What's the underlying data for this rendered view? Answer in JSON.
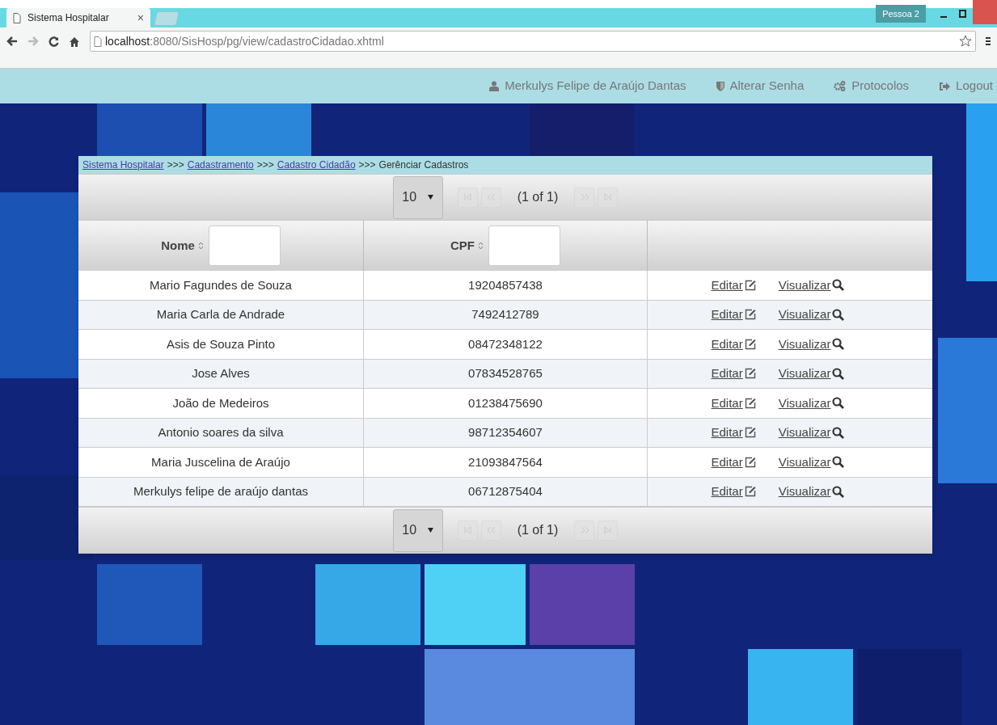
{
  "browser": {
    "tab_title": "Sistema Hospitalar",
    "tab_close": "×",
    "profile": "Pessoa 2",
    "url_host": "localhost",
    "url_path": ":8080/SisHosp/pg/view/cadastroCidadao.xhtml"
  },
  "navbar": {
    "items": [
      {
        "kind": "user",
        "label": "Merkulys Felipe de Araújo Dantas"
      },
      {
        "kind": "shield",
        "label": "Alterar Senha"
      },
      {
        "kind": "gears",
        "label": "Protocolos"
      },
      {
        "kind": "logout",
        "label": "Logout"
      }
    ]
  },
  "breadcrumb": {
    "links": [
      "Sistema Hospitalar",
      "Cadastramento",
      "Cadastro Cidadão"
    ],
    "separator": ">>>",
    "current": "Gerênciar Cadastros"
  },
  "paginator_top": {
    "page_size": "10",
    "report": "(1 of 1)",
    "buttons": [
      {
        "kind": "first",
        "disabled": true
      },
      {
        "kind": "prev",
        "disabled": true
      },
      {
        "kind": "next",
        "disabled": true
      },
      {
        "kind": "last",
        "disabled": true
      }
    ]
  },
  "table": {
    "columns": [
      {
        "label": "Nome",
        "sortable": true,
        "filter": true
      },
      {
        "label": "CPF",
        "sortable": true,
        "filter": true
      },
      {
        "sortable": false,
        "filter": false
      }
    ],
    "rows": [
      {
        "nome": "Mario Fagundes de Souza",
        "cpf": "19204857438",
        "actions": [
          "Editar",
          "Visualizar"
        ]
      },
      {
        "nome": "Maria Carla de Andrade",
        "cpf": "7492412789",
        "actions": [
          "Editar",
          "Visualizar"
        ]
      },
      {
        "nome": "Asis de Souza Pinto",
        "cpf": "08472348122",
        "actions": [
          "Editar",
          "Visualizar"
        ]
      },
      {
        "nome": "Jose Alves",
        "cpf": "07834528765",
        "actions": [
          "Editar",
          "Visualizar"
        ]
      },
      {
        "nome": "João de Medeiros",
        "cpf": "01238475690",
        "actions": [
          "Editar",
          "Visualizar"
        ]
      },
      {
        "nome": "Antonio soares da silva",
        "cpf": "98712354607",
        "actions": [
          "Editar",
          "Visualizar"
        ]
      },
      {
        "nome": "Maria Juscelina de Araújo",
        "cpf": "21093847564",
        "actions": [
          "Editar",
          "Visualizar"
        ]
      },
      {
        "nome": "Merkulys felipe de araújo dantas",
        "cpf": "06712875404",
        "actions": [
          "Editar",
          "Visualizar"
        ]
      }
    ]
  },
  "paginator_bottom": {
    "page_size": "10",
    "report": "(1 of 1)",
    "buttons": [
      {
        "kind": "first",
        "disabled": true
      },
      {
        "kind": "prev",
        "disabled": true
      },
      {
        "kind": "next",
        "disabled": true
      },
      {
        "kind": "last",
        "disabled": true
      }
    ]
  }
}
